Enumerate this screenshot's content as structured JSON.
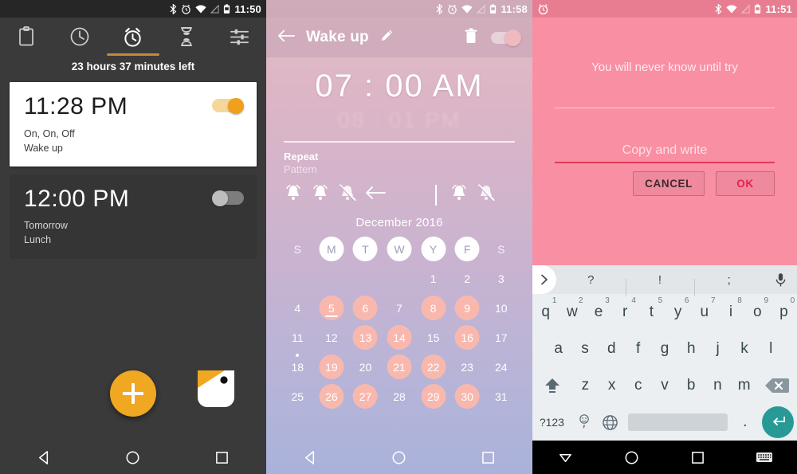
{
  "panel1": {
    "name": "alarm-list-screen",
    "statusbar": {
      "icons": [
        "bluetooth-icon",
        "alarm-icon",
        "wifi-icon",
        "signal-off-icon",
        "battery-icon"
      ],
      "time": "11:50"
    },
    "tabs": [
      {
        "name": "tab-clipboard",
        "icon": "clipboard-icon",
        "active": false
      },
      {
        "name": "tab-clock",
        "icon": "clock-icon",
        "active": false
      },
      {
        "name": "tab-alarm",
        "icon": "alarm-clock-icon",
        "active": true
      },
      {
        "name": "tab-timer",
        "icon": "hourglass-icon",
        "active": false
      },
      {
        "name": "tab-settings",
        "icon": "sliders-icon",
        "active": false
      }
    ],
    "accent_color": "#c8873a",
    "next_alarm_text": "23 hours 37 minutes  left",
    "alarms": [
      {
        "time": "11:28 PM",
        "repeat": "On, On, Off",
        "label": "Wake up",
        "enabled": true
      },
      {
        "time": "12:00 PM",
        "repeat": "Tomorrow",
        "label": "Lunch",
        "enabled": false
      }
    ],
    "fab": {
      "name": "add-alarm-button",
      "icon": "plus-icon"
    },
    "brand_icon": "bird-tag-icon",
    "navbar": [
      "back-icon",
      "home-icon",
      "recents-icon"
    ]
  },
  "panel2": {
    "name": "alarm-edit-screen",
    "statusbar": {
      "icons": [
        "bluetooth-icon",
        "alarm-icon",
        "wifi-icon",
        "signal-off-icon",
        "battery-icon"
      ],
      "time": "11:58"
    },
    "appbar": {
      "back_icon": "back-arrow-icon",
      "title": "Wake up",
      "edit_icon": "pencil-icon",
      "delete_icon": "trash-icon",
      "toggle_on": true
    },
    "time_selected": "07 : 00 AM",
    "time_faded": "08 : 01 PM",
    "repeat_label": "Repeat",
    "pattern_label": "Pattern",
    "pattern_bells_left": [
      "bell-on-icon",
      "bell-on-icon",
      "bell-off-icon"
    ],
    "pattern_back_icon": "back-arrow-icon",
    "pattern_bells_right": [
      "bell-on-icon",
      "bell-off-icon"
    ],
    "month": "December 2016",
    "dow": [
      {
        "label": "S",
        "highlight": false
      },
      {
        "label": "M",
        "highlight": true
      },
      {
        "label": "T",
        "highlight": true
      },
      {
        "label": "W",
        "highlight": true
      },
      {
        "label": "Y",
        "highlight": true
      },
      {
        "label": "F",
        "highlight": true
      },
      {
        "label": "S",
        "highlight": false
      }
    ],
    "weeks": [
      [
        {
          "d": ""
        },
        {
          "d": ""
        },
        {
          "d": ""
        },
        {
          "d": ""
        },
        {
          "d": "1"
        },
        {
          "d": "2"
        },
        {
          "d": "3"
        }
      ],
      [
        {
          "d": "4"
        },
        {
          "d": "5",
          "sel": true,
          "underline": true
        },
        {
          "d": "6",
          "sel": true
        },
        {
          "d": "7"
        },
        {
          "d": "8",
          "sel": true
        },
        {
          "d": "9",
          "sel": true
        },
        {
          "d": "10"
        }
      ],
      [
        {
          "d": "11"
        },
        {
          "d": "12"
        },
        {
          "d": "13",
          "sel": true
        },
        {
          "d": "14",
          "sel": true
        },
        {
          "d": "15"
        },
        {
          "d": "16",
          "sel": true
        },
        {
          "d": "17"
        }
      ],
      [
        {
          "d": "18",
          "dot": true
        },
        {
          "d": "19",
          "sel": true
        },
        {
          "d": "20"
        },
        {
          "d": "21",
          "sel": true
        },
        {
          "d": "22",
          "sel": true
        },
        {
          "d": "23"
        },
        {
          "d": "24"
        }
      ],
      [
        {
          "d": "25"
        },
        {
          "d": "26",
          "sel": true
        },
        {
          "d": "27",
          "sel": true
        },
        {
          "d": "28"
        },
        {
          "d": "29",
          "sel": true
        },
        {
          "d": "30",
          "sel": true
        },
        {
          "d": "31"
        }
      ]
    ],
    "navbar": [
      "back-icon",
      "home-icon",
      "recents-icon"
    ]
  },
  "panel3": {
    "name": "copy-and-write-dialog-screen",
    "statusbar": {
      "app_icon": "alarm-clock-icon",
      "icons": [
        "bluetooth-icon",
        "wifi-icon",
        "signal-off-icon",
        "battery-icon"
      ],
      "time": "11:51"
    },
    "quote": "You will never know until try",
    "input_placeholder": "Copy and write",
    "input_value": "",
    "underline_color": "#e23a5c",
    "buttons": [
      {
        "name": "cancel-button",
        "label": "CANCEL"
      },
      {
        "name": "ok-button",
        "label": "OK"
      }
    ],
    "keyboard": {
      "suggestions": [
        "?",
        "!",
        ";"
      ],
      "expand_icon": "chevron-right-icon",
      "mic_icon": "microphone-icon",
      "row1": [
        {
          "k": "q",
          "n": "1"
        },
        {
          "k": "w",
          "n": "2"
        },
        {
          "k": "e",
          "n": "3"
        },
        {
          "k": "r",
          "n": "4"
        },
        {
          "k": "t",
          "n": "5"
        },
        {
          "k": "y",
          "n": "6"
        },
        {
          "k": "u",
          "n": "7"
        },
        {
          "k": "i",
          "n": "8"
        },
        {
          "k": "o",
          "n": "9"
        },
        {
          "k": "p",
          "n": "0"
        }
      ],
      "row2": [
        {
          "k": "a"
        },
        {
          "k": "s"
        },
        {
          "k": "d"
        },
        {
          "k": "f"
        },
        {
          "k": "g"
        },
        {
          "k": "h"
        },
        {
          "k": "j"
        },
        {
          "k": "k"
        },
        {
          "k": "l"
        }
      ],
      "row3": [
        {
          "k": "z"
        },
        {
          "k": "x"
        },
        {
          "k": "c"
        },
        {
          "k": "v"
        },
        {
          "k": "b"
        },
        {
          "k": "n"
        },
        {
          "k": "m"
        }
      ],
      "shift_icon": "shift-icon",
      "backspace_icon": "backspace-icon",
      "symbols_key": "?123",
      "emoji_key": "emoji-comma-icon",
      "globe_icon": "globe-icon",
      "period_key": ".",
      "enter_icon": "enter-icon",
      "enter_color": "#279a96"
    },
    "navbar": [
      "hide-keyboard-icon",
      "home-icon",
      "recents-icon",
      "keyboard-switch-icon"
    ]
  }
}
